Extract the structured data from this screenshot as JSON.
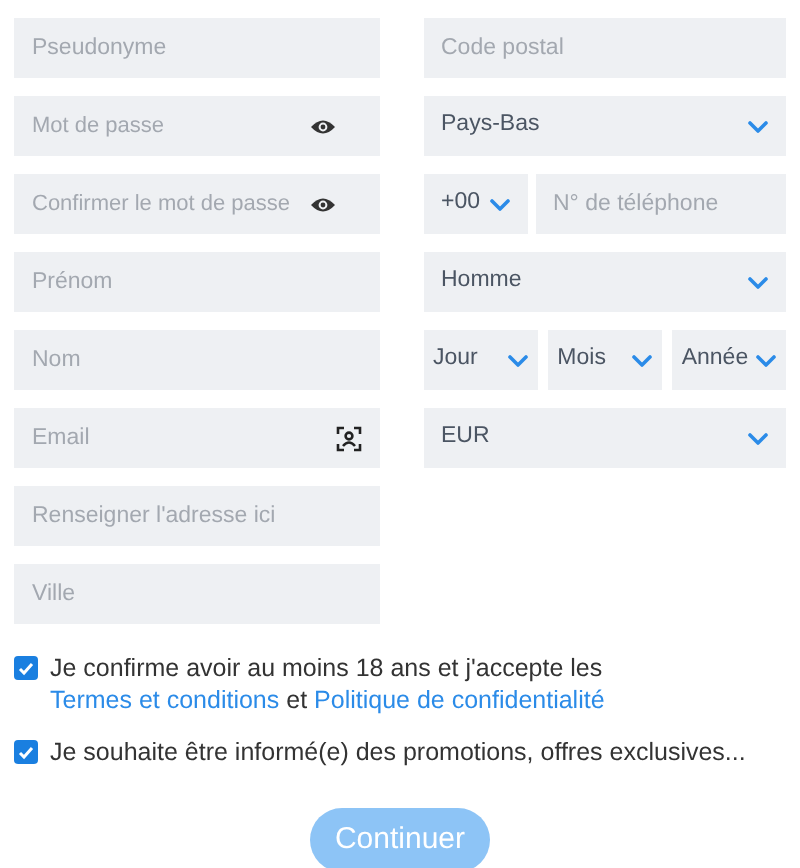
{
  "left_fields": [
    {
      "kind": "text",
      "placeholder": "Pseudonyme"
    },
    {
      "kind": "password",
      "placeholder": "Mot de passe"
    },
    {
      "kind": "password",
      "placeholder": "Confirmer le mot de passe"
    },
    {
      "kind": "text",
      "placeholder": "Prénom"
    },
    {
      "kind": "text",
      "placeholder": "Nom"
    },
    {
      "kind": "email",
      "placeholder": "Email"
    },
    {
      "kind": "text",
      "placeholder": "Renseigner l'adresse ici"
    },
    {
      "kind": "text",
      "placeholder": "Ville"
    }
  ],
  "right_fields": [
    {
      "kind": "text",
      "placeholder": "Code postal"
    },
    {
      "kind": "select",
      "value": "Pays-Bas"
    },
    {
      "kind": "phone",
      "code": "+00",
      "placeholder": "N° de téléphone"
    },
    {
      "kind": "select",
      "value": "Homme"
    },
    {
      "kind": "date",
      "parts": [
        "Jour",
        "Mois",
        "Année"
      ]
    },
    {
      "kind": "select",
      "value": "EUR"
    }
  ],
  "consents": [
    {
      "checked": true,
      "parts": [
        {
          "kind": "text",
          "text": "Je confirme avoir au moins 18 ans et j'accepte les"
        },
        {
          "kind": "link",
          "text": "Termes et conditions"
        },
        {
          "kind": "text",
          "text": "et"
        },
        {
          "kind": "link",
          "text": "Politique de confidentialité"
        }
      ]
    },
    {
      "checked": true,
      "parts": [
        {
          "kind": "text",
          "text": "Je souhaite être informé(e) des promotions, offres exclusives..."
        }
      ]
    }
  ],
  "submit": {
    "label": "Continuer",
    "disabled": true
  }
}
